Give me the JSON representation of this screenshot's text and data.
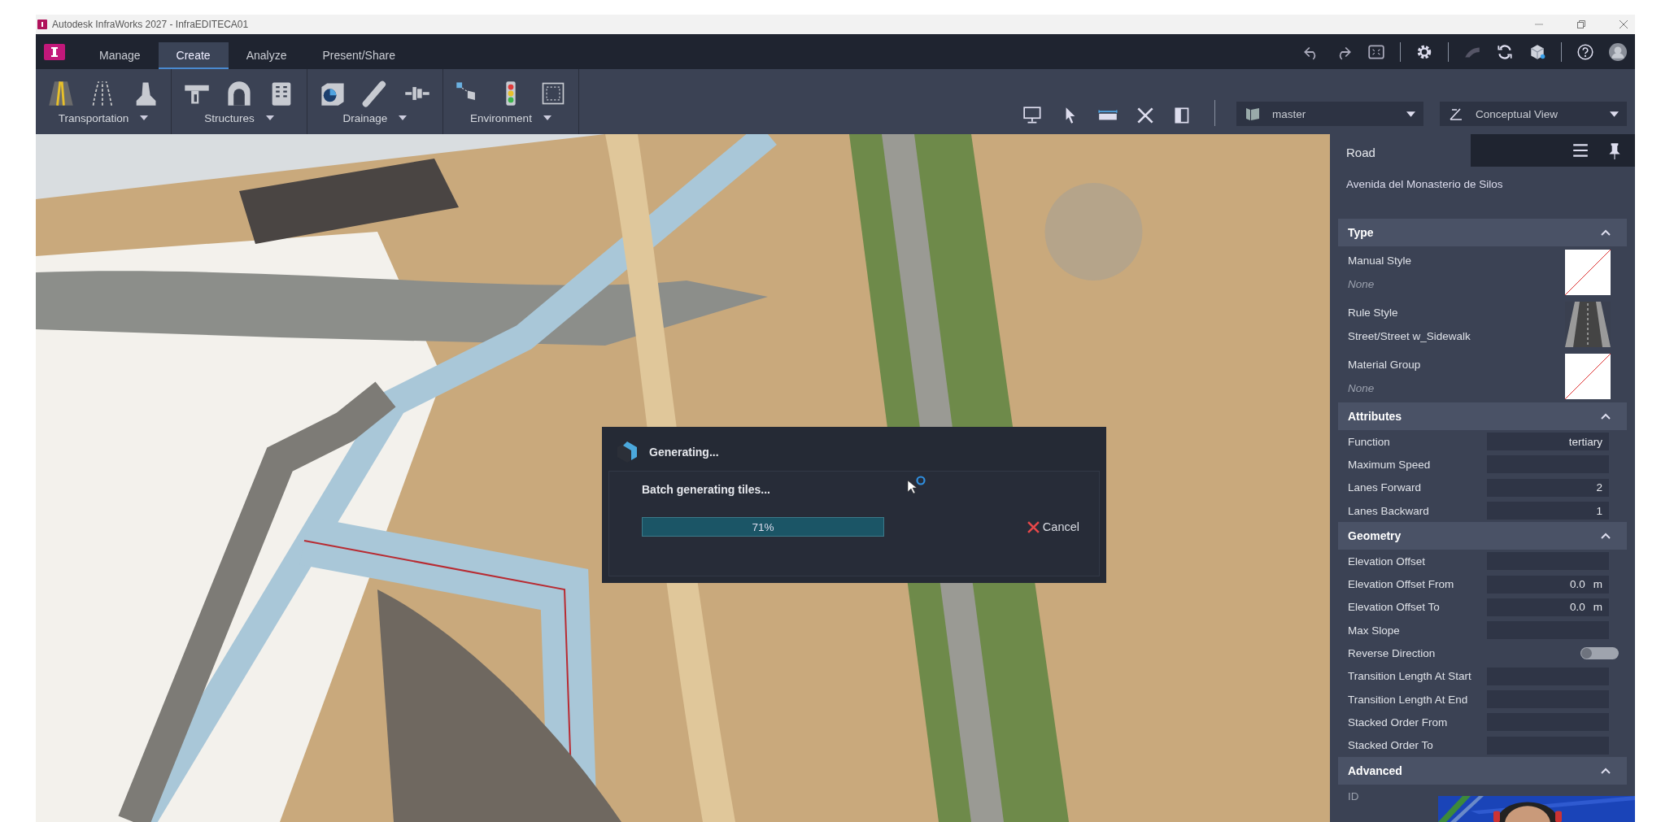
{
  "window": {
    "title": "Autodesk InfraWorks 2027 - InfraEDITECA01"
  },
  "tabs": [
    {
      "label": "Manage",
      "selected": false
    },
    {
      "label": "Create",
      "selected": true
    },
    {
      "label": "Analyze",
      "selected": false
    },
    {
      "label": "Present/Share",
      "selected": false
    }
  ],
  "ribbon_groups": [
    {
      "label": "Transportation",
      "kind": "transportation"
    },
    {
      "label": "Structures",
      "kind": "structures"
    },
    {
      "label": "Drainage",
      "kind": "drainage"
    },
    {
      "label": "Environment",
      "kind": "environment"
    }
  ],
  "dropdowns": [
    {
      "value": "master",
      "kind": "proposal"
    },
    {
      "value": "Conceptual View",
      "kind": "view"
    }
  ],
  "dialog": {
    "title": "Generating...",
    "message": "Batch generating tiles...",
    "progress": {
      "level": 0.71,
      "reading": "71%"
    },
    "cancel_label": "Cancel"
  },
  "panel": {
    "title": "Road",
    "subtitle": "Avenida del Monasterio de Silos",
    "sections": [
      {
        "title": "Type",
        "expanded": true,
        "rows": [
          {
            "kind": "style",
            "label": "Manual Style",
            "value": "None",
            "empty": true
          },
          {
            "kind": "style",
            "label": "Rule Style",
            "value": "Street/Street w_Sidewalk",
            "empty": false
          },
          {
            "kind": "style",
            "label": "Material Group",
            "value": "None",
            "empty": true
          }
        ]
      },
      {
        "title": "Attributes",
        "expanded": true,
        "rows": [
          {
            "kind": "field",
            "label": "Function",
            "value": "tertiary"
          },
          {
            "kind": "field",
            "label": "Maximum Speed"
          },
          {
            "kind": "field",
            "label": "Lanes Forward",
            "value": "2"
          },
          {
            "kind": "field",
            "label": "Lanes Backward",
            "value": "1"
          }
        ]
      },
      {
        "title": "Geometry",
        "expanded": true,
        "rows": [
          {
            "kind": "field",
            "label": "Elevation Offset"
          },
          {
            "kind": "field",
            "label": "Elevation Offset From",
            "value": "0.0",
            "unit": "m"
          },
          {
            "kind": "field",
            "label": "Elevation Offset To",
            "value": "0.0",
            "unit": "m"
          },
          {
            "kind": "field",
            "label": "Max Slope"
          },
          {
            "kind": "toggle",
            "label": "Reverse Direction",
            "on": false
          },
          {
            "kind": "field",
            "label": "Transition Length At Start"
          },
          {
            "kind": "field",
            "label": "Transition Length At End"
          },
          {
            "kind": "field",
            "label": "Stacked Order From"
          },
          {
            "kind": "field",
            "label": "Stacked Order To"
          }
        ]
      },
      {
        "title": "Advanced",
        "expanded": true,
        "rows": [
          {
            "kind": "label",
            "label": "ID"
          }
        ]
      }
    ]
  }
}
